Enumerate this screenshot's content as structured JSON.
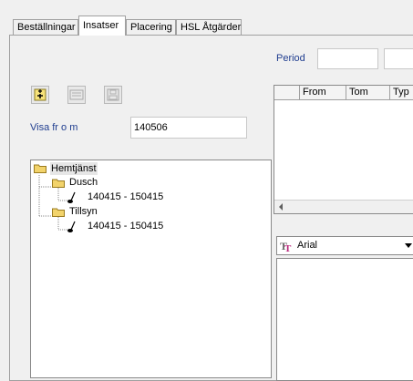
{
  "tabs": [
    {
      "label": "Beställningar",
      "active": false
    },
    {
      "label": "Insatser",
      "active": true
    },
    {
      "label": "Placering",
      "active": false
    },
    {
      "label": "HSL Åtgärder",
      "active": false
    }
  ],
  "period": {
    "label": "Period",
    "value1": "",
    "value2": ""
  },
  "toolbar": {
    "icons": [
      "add-icon",
      "edit-icon",
      "save-icon"
    ]
  },
  "visa": {
    "label": "Visa fr o m",
    "value": "140506"
  },
  "tree": {
    "root": "Hemtjänst",
    "groups": [
      {
        "name": "Dusch",
        "period": "140415 - 150415"
      },
      {
        "name": "Tillsyn",
        "period": "140415 - 150415"
      }
    ]
  },
  "grid": {
    "columns": [
      "",
      "From",
      "Tom",
      "Typ"
    ]
  },
  "font": {
    "name": "Arial",
    "icon": "truetype-icon"
  },
  "colors": {
    "label_blue": "#1f3d8f",
    "folder_yellow": "#f2d36b"
  }
}
